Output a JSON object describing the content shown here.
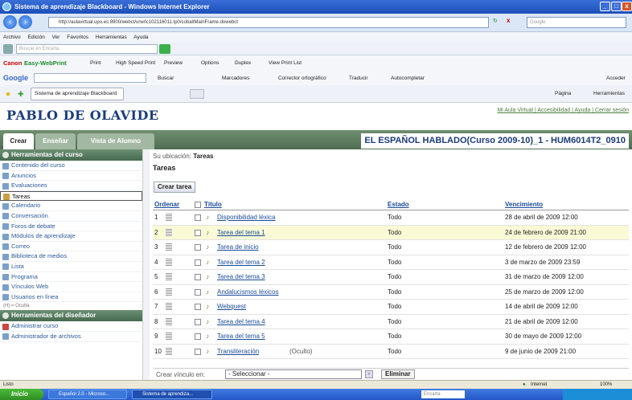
{
  "window": {
    "title": "Sistema de aprendizaje Blackboard - Windows Internet Explorer"
  },
  "address": {
    "url": "http://aulavirtual.upo.es:8900/webct/urw/lc102116011.tp0/cobaltMainFrame.dowebct",
    "search_placeholder": "Google"
  },
  "menu": [
    "Archivo",
    "Edición",
    "Ver",
    "Favoritos",
    "Herramientas",
    "Ayuda"
  ],
  "toolbar1": {
    "search_placeholder": "Buscar en Encarta"
  },
  "toolbar2": {
    "brand1": "Canon",
    "brand2": "Easy-WebPrint",
    "items": [
      "Print",
      "High Speed Print",
      "Preview",
      "Options",
      "Duplex",
      "View Print List"
    ]
  },
  "toolbar3": {
    "brand": "Google",
    "search": "Buscar",
    "bookmarks": "Marcadores",
    "spell": "Corrector ortográfico",
    "translate": "Traducir",
    "autofill": "Autocompletar",
    "signin": "Acceder"
  },
  "toolbar4": {
    "tab": "Sistema de aprendizaje Blackboard",
    "page": "Página",
    "tools": "Herramientas"
  },
  "header": {
    "logo": "PABLO DE OLAVIDE",
    "links": "Mi Aula Virtual | Accesibilidad | Ayuda | Cerrar sesión",
    "course": "EL ESPAÑOL HABLADO(Curso 2009-10)_1 - HUM6014T2_0910"
  },
  "tabs": [
    "Crear",
    "Enseñar",
    "Vista de Alumno"
  ],
  "sidebar": {
    "heading1": "Herramientas del curso",
    "items": [
      "Contenido del curso",
      "Anuncios",
      "Evaluaciones",
      "Tareas",
      "Calendario",
      "Conversación",
      "Foros de debate",
      "Módulos de aprendizaje",
      "Correo",
      "Biblioteca de medios",
      "Lista",
      "Programa",
      "Vínculos Web",
      "Usuarios en línea"
    ],
    "hidden_note": "(H) = Oculta",
    "heading2": "Herramientas del diseñador",
    "items2": [
      "Administrar curso",
      "Administrador de archivos"
    ]
  },
  "main": {
    "breadcrumb_label": "Su ubicación:",
    "breadcrumb_value": "Tareas",
    "title": "Tareas",
    "new_button": "Crear tarea",
    "columns": {
      "order": "Ordenar",
      "title": "Título",
      "state": "Estado",
      "due": "Vencimiento"
    },
    "rows": [
      {
        "n": "1",
        "title": "Disponibilidad léxica",
        "state": "Todo",
        "due": "28 de abril de 2009 12:00"
      },
      {
        "n": "2",
        "title": "Tarea del tema 1",
        "state": "Todo",
        "due": "24 de febrero de 2009 21:00"
      },
      {
        "n": "3",
        "title": "Tarea de inicio",
        "state": "Todo",
        "due": "12 de febrero de 2009 12:00"
      },
      {
        "n": "4",
        "title": "Tarea del tema 2",
        "state": "Todo",
        "due": "3 de marzo de 2009 23:59"
      },
      {
        "n": "5",
        "title": "Tarea del tema 3",
        "state": "Todo",
        "due": "31 de marzo de 2009 12:00"
      },
      {
        "n": "6",
        "title": "Andalucismos léxicos",
        "state": "Todo",
        "due": "25 de marzo de 2009 12:00"
      },
      {
        "n": "7",
        "title": "Webquest",
        "state": "Todo",
        "due": "14 de abril de 2009 12:00"
      },
      {
        "n": "8",
        "title": "Tarea del tema 4",
        "state": "Todo",
        "due": "21 de abril de 2009 12:00"
      },
      {
        "n": "9",
        "title": "Tarea del tema 5",
        "state": "Todo",
        "due": "30 de mayo de 2009 12:00"
      },
      {
        "n": "10",
        "title": "Transliteración",
        "hidden": "(Oculto)",
        "state": "Todo",
        "due": "9 de junio de 2009 21:00"
      }
    ],
    "link_label": "Crear vínculo en:",
    "select_value": "- Seleccionar -",
    "delete": "Eliminar"
  },
  "status": {
    "left": "Listo",
    "zone": "Internet",
    "zoom": "100%"
  },
  "taskbar": {
    "start": "Inicio",
    "task1": "Español 2.0 - Microso...",
    "task2": "Sistema de aprendiza...",
    "search": "Encarta"
  }
}
